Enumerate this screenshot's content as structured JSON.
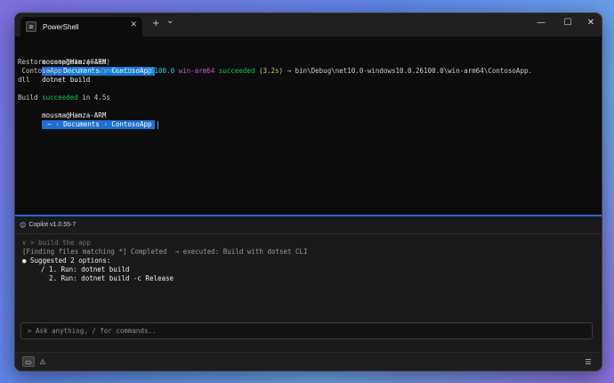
{
  "tab": {
    "title": "PowerShell",
    "close": "✕",
    "icon": "terminal-icon",
    "icon_glyph": "≥"
  },
  "titlebar": {
    "new_tab": "+",
    "dropdown": "⌄",
    "minimize": "—",
    "maximize": "☐",
    "close": "✕"
  },
  "terminal": {
    "prompt_user": "mousma@Hamza-ARM",
    "path_home": "~",
    "path_1": "Documents",
    "path_2": "ContosoApp",
    "path_sep": "›",
    "command": "dotnet build",
    "line_restore": "Restore complete (0.5s)",
    "build_project": "ContosoApp",
    "build_target": "net10.0-windows10.0.26100.0",
    "build_arch": "win-arm64",
    "build_status": "succeeded",
    "build_time": "(3.2s)",
    "build_output": "→ bin\\Debug\\net10.0-windows10.0.26100.0\\win-arm64\\ContosoApp.",
    "build_output_cont": "dll",
    "summary_prefix": "Build",
    "summary_status": "succeeded",
    "summary_suffix": "in 4.5s"
  },
  "copilot": {
    "version": "Copilot v1.0.55-7",
    "icon": "copilot-icon",
    "icon_glyph": "☺",
    "history_line": "∨ > build the app",
    "finding_line": "[Finding files matching *] Completed  → executed: Build with dotset CLI",
    "suggested_line": "● Suggested 2 options:",
    "option_1": "  / 1. Run: dotnet build",
    "option_2": "    2. Run: dotnet build -c Release",
    "ask_placeholder": "> Ask anything, / for commands.."
  },
  "bottombar": {
    "left_icon_1": "terminal-panel-icon",
    "left_icon_1_glyph": "▭",
    "left_icon_2": "warning-icon",
    "left_icon_2_glyph": "⚠",
    "right_icon": "list-icon",
    "right_icon_glyph": "☰"
  },
  "colors": {
    "accent": "#1f86e0",
    "success": "#13c254",
    "cyan": "#3ac6e0",
    "magenta": "#c05bd1"
  }
}
